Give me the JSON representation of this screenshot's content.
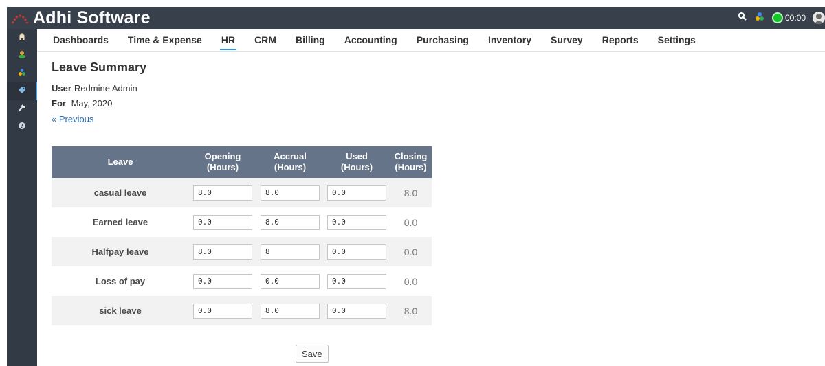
{
  "app": {
    "title": "Adhi Software",
    "logo_icon": "logo-arc-icon",
    "brand_color": "#38404c"
  },
  "topbar": {
    "timer_text": "00:00",
    "timer_color": "#13c728",
    "icons": [
      "search-icon",
      "apps-icon",
      "timer-icon",
      "avatar"
    ]
  },
  "sidebar": {
    "items": [
      {
        "icon": "home-icon"
      },
      {
        "icon": "user-icon"
      },
      {
        "icon": "apps-icon"
      },
      {
        "icon": "tag-icon",
        "active": true
      },
      {
        "icon": "wrench-icon"
      },
      {
        "icon": "help-icon"
      }
    ]
  },
  "nav": {
    "items": [
      {
        "label": "Dashboards"
      },
      {
        "label": "Time & Expense"
      },
      {
        "label": "HR",
        "active": true
      },
      {
        "label": "CRM"
      },
      {
        "label": "Billing"
      },
      {
        "label": "Accounting"
      },
      {
        "label": "Purchasing"
      },
      {
        "label": "Inventory"
      },
      {
        "label": "Survey"
      },
      {
        "label": "Reports"
      },
      {
        "label": "Settings"
      }
    ],
    "active_color": "#2e95db"
  },
  "page": {
    "title": "Leave Summary",
    "user_label": "User",
    "user_value": "Redmine Admin",
    "for_label": "For",
    "for_value": "May, 2020",
    "previous_link": "« Previous"
  },
  "table": {
    "header_color": "#66748a",
    "columns": {
      "leave": "Leave",
      "opening_1": "Opening",
      "opening_2": "(Hours)",
      "accrual_1": "Accrual",
      "accrual_2": "(Hours)",
      "used_1": "Used",
      "used_2": "(Hours)",
      "closing_1": "Closing",
      "closing_2": "(Hours)"
    },
    "rows": [
      {
        "leave": "casual leave",
        "opening": "8.0",
        "accrual": "8.0",
        "used": "0.0",
        "closing": "8.0"
      },
      {
        "leave": "Earned leave",
        "opening": "0.0",
        "accrual": "8.0",
        "used": "0.0",
        "closing": "0.0"
      },
      {
        "leave": "Halfpay leave",
        "opening": "8.0",
        "accrual": "8",
        "used": "0.0",
        "closing": "0.0"
      },
      {
        "leave": "Loss of pay",
        "opening": "0.0",
        "accrual": "0.0",
        "used": "0.0",
        "closing": "0.0"
      },
      {
        "leave": "sick leave",
        "opening": "0.0",
        "accrual": "8.0",
        "used": "0.0",
        "closing": "8.0"
      }
    ]
  },
  "actions": {
    "save_label": "Save"
  }
}
